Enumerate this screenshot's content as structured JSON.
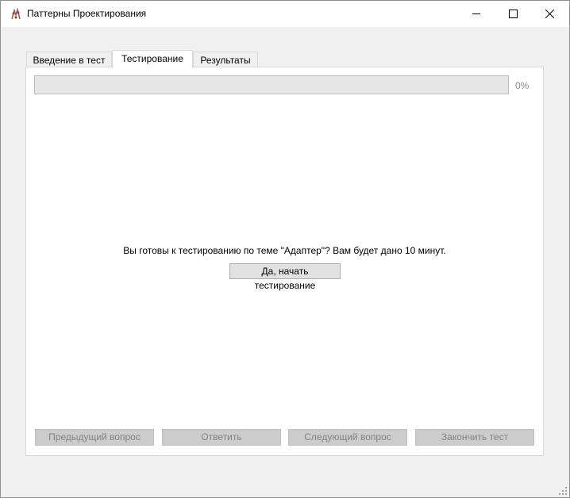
{
  "window": {
    "title": "Паттерны Проектирования",
    "icon": "app-icon"
  },
  "tabs": [
    {
      "label": "Введение в тест",
      "active": false
    },
    {
      "label": "Тестирование",
      "active": true
    },
    {
      "label": "Результаты",
      "active": false
    }
  ],
  "progress": {
    "value": 0,
    "label": "0%"
  },
  "main": {
    "question": "Вы готовы к тестированию по теме \"Адаптер\"? Вам будет дано 10 минут.",
    "start_button": "Да, начать тестирование"
  },
  "nav_buttons": {
    "prev": "Предыдущий вопрос",
    "answer": "Ответить",
    "next": "Следующий вопрос",
    "finish": "Закончить тест"
  },
  "colors": {
    "button_face": "#e1e1e1",
    "disabled_button": "#cccccc",
    "disabled_text": "#838383",
    "progress_track": "#e6e6e6"
  }
}
